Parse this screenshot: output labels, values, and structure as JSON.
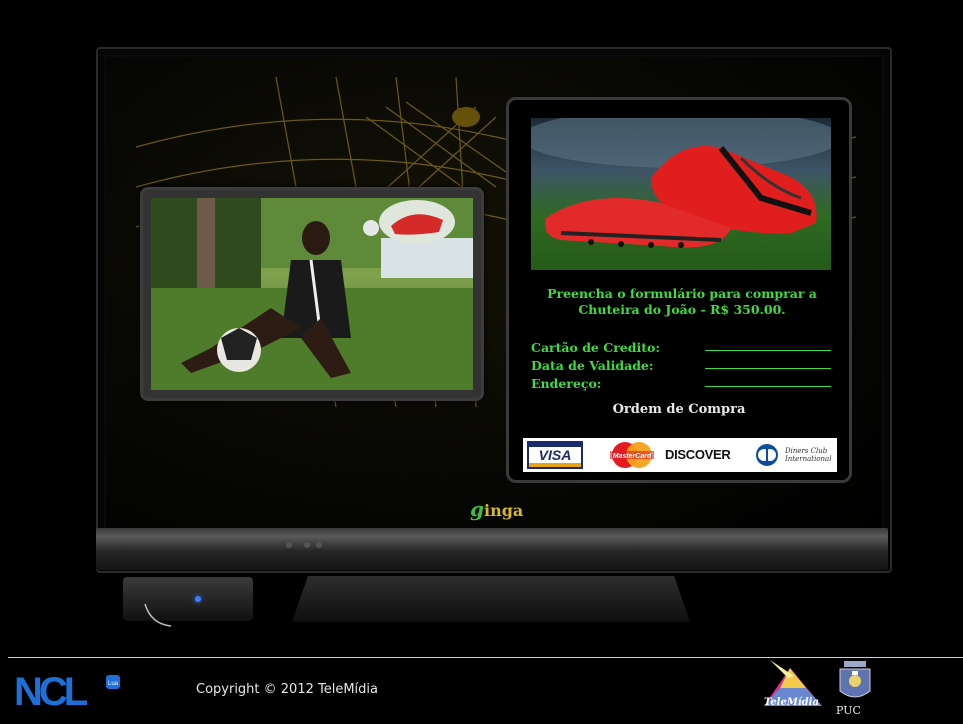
{
  "footer": {
    "copyright": "Copyright © 2012 TeleMídia",
    "ncl_logo_text": "NCL",
    "ncl_logo_badge": "Lua",
    "telemidia_text": "TeleMídia",
    "puc_text": "PUC"
  },
  "tv": {
    "brand": "ginga",
    "order_panel": {
      "promo_line1": "Preencha o formulário para comprar a",
      "promo_line2": "Chuteira do João - R$ 350.00.",
      "fields": [
        {
          "label": "Cartão de Credito:",
          "value": ""
        },
        {
          "label": "Data de Validade:",
          "value": ""
        },
        {
          "label": "Endereço:",
          "value": ""
        }
      ],
      "order_button": "Ordem de Compra",
      "card_logos": {
        "visa": "VISA",
        "mastercard": "MasterCard",
        "discover": "DISCOVER",
        "diners_line1": "Diners Club",
        "diners_line2": "International"
      }
    }
  },
  "colors": {
    "form_green": "#3fdc3f",
    "ginga_gold": "#d7b82a",
    "background": "#000000"
  }
}
